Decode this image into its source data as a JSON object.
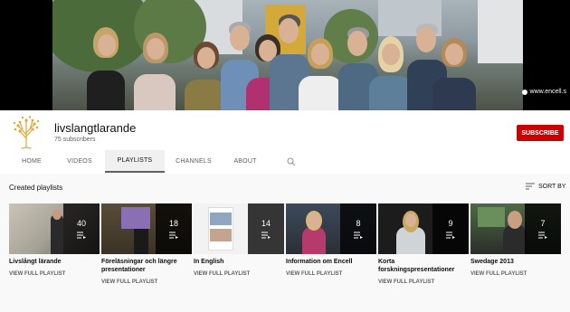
{
  "banner": {
    "url_text": "www.encell.s"
  },
  "channel": {
    "name": "livslangtlarande",
    "subscribers": "75 subscribers",
    "subscribe_label": "SUBSCRIBE"
  },
  "tabs": [
    {
      "label": "HOME",
      "active": false
    },
    {
      "label": "VIDEOS",
      "active": false
    },
    {
      "label": "PLAYLISTS",
      "active": true
    },
    {
      "label": "CHANNELS",
      "active": false
    },
    {
      "label": "ABOUT",
      "active": false
    }
  ],
  "section": {
    "title": "Created playlists",
    "sort_label": "SORT BY"
  },
  "playlists": [
    {
      "title": "Livslångt lärande",
      "count": "40",
      "link": "VIEW FULL PLAYLIST"
    },
    {
      "title": "Föreläsningar och längre presentationer",
      "count": "18",
      "link": "VIEW FULL PLAYLIST"
    },
    {
      "title": "In English",
      "count": "14",
      "link": "VIEW FULL PLAYLIST"
    },
    {
      "title": "Information om Encell",
      "count": "8",
      "link": "VIEW FULL PLAYLIST"
    },
    {
      "title": "Korta forskningspresentationer",
      "count": "9",
      "link": "VIEW FULL PLAYLIST"
    },
    {
      "title": "Swedage 2013",
      "count": "7",
      "link": "VIEW FULL PLAYLIST"
    }
  ],
  "icons": {
    "search": "search-icon",
    "sort": "sort-icon",
    "playlist": "playlist-icon",
    "avatar": "tree-logo-icon"
  },
  "colors": {
    "subscribe": "#cc0000",
    "avatar_gold": "#e0a83a"
  }
}
